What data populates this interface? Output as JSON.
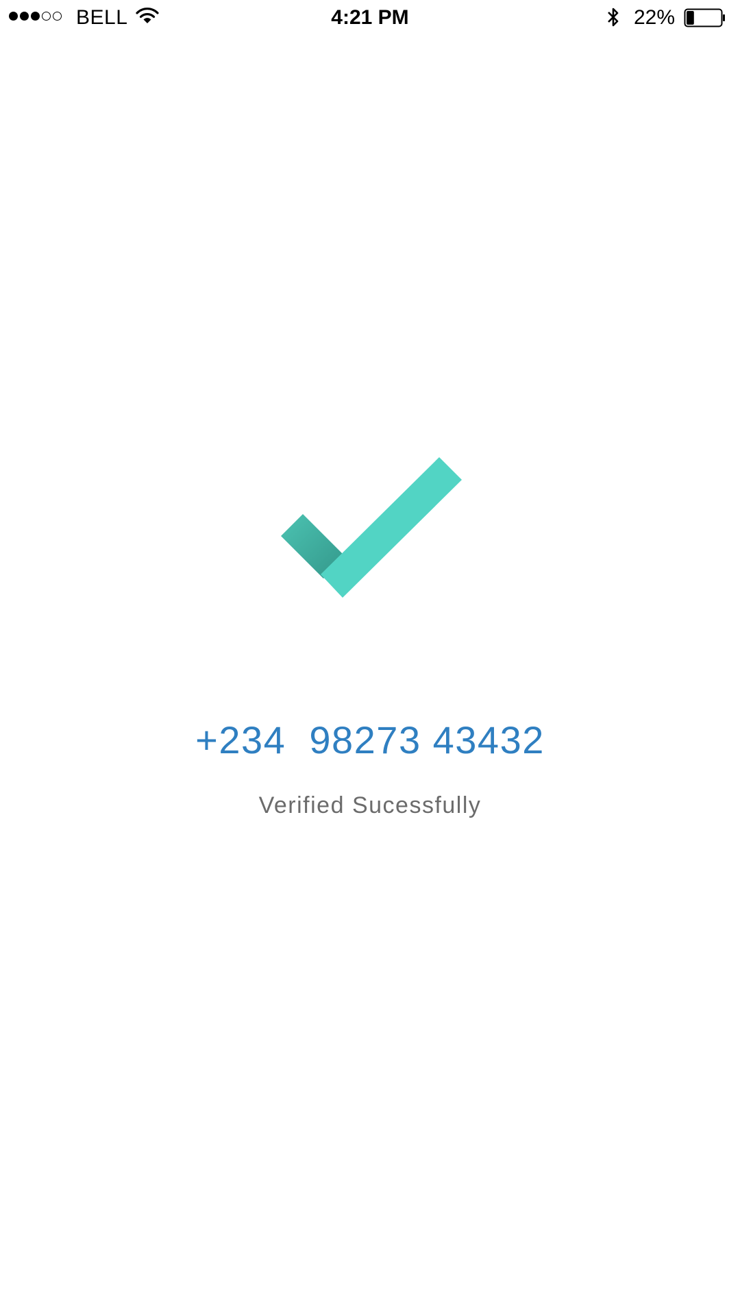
{
  "status_bar": {
    "signal_bars_filled": 3,
    "signal_bars_total": 5,
    "carrier": "BELL",
    "time": "4:21 PM",
    "battery_percent": "22%",
    "battery_level": 0.22,
    "icons": [
      "signal-icon",
      "wifi-icon",
      "bluetooth-icon",
      "battery-icon"
    ]
  },
  "verification": {
    "icon": "checkmark-icon",
    "phone_number": "+234  98273 43432",
    "message": "Verified Sucessfully"
  },
  "colors": {
    "check_light": "#52d4c4",
    "check_dark": "#3aa897",
    "phone_number": "#2f7fc1",
    "message": "#6b6b6b"
  }
}
